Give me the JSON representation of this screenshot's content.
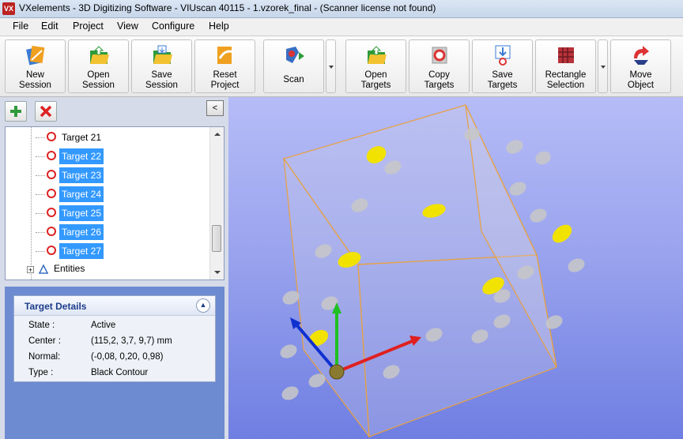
{
  "window": {
    "app_icon_text": "VX",
    "title": "VXelements - 3D Digitizing Software - VIUscan 40115 - 1.vzorek_final - (Scanner license not found)"
  },
  "menu": [
    "File",
    "Edit",
    "Project",
    "View",
    "Configure",
    "Help"
  ],
  "toolbar": {
    "buttons": [
      {
        "label": "New\nSession",
        "icon": "new-session-icon"
      },
      {
        "label": "Open\nSession",
        "icon": "open-session-icon"
      },
      {
        "label": "Save\nSession",
        "icon": "save-session-icon"
      },
      {
        "label": "Reset\nProject",
        "icon": "reset-project-icon"
      },
      {
        "label": "Scan",
        "icon": "scan-icon"
      },
      {
        "label": "Open\nTargets",
        "icon": "open-targets-icon"
      },
      {
        "label": "Copy\nTargets",
        "icon": "copy-targets-icon"
      },
      {
        "label": "Save\nTargets",
        "icon": "save-targets-icon"
      },
      {
        "label": "Rectangle\nSelection",
        "icon": "rectangle-selection-icon"
      },
      {
        "label": "Move\nObject",
        "icon": "move-object-icon"
      }
    ]
  },
  "panel": {
    "add_icon": "plus-icon",
    "remove_icon": "x-icon",
    "collapse_label": "<",
    "tree_items": [
      {
        "label": "Target 21",
        "selected": false
      },
      {
        "label": "Target 22",
        "selected": true
      },
      {
        "label": "Target 23",
        "selected": true
      },
      {
        "label": "Target 24",
        "selected": true
      },
      {
        "label": "Target 25",
        "selected": true
      },
      {
        "label": "Target 26",
        "selected": true
      },
      {
        "label": "Target 27",
        "selected": true
      }
    ],
    "entities_label": "Entities"
  },
  "details": {
    "title": "Target Details",
    "rows": [
      {
        "key": "State :",
        "value": "Active"
      },
      {
        "key": "Center :",
        "value": "(115,2, 3,7, 9,7) mm"
      },
      {
        "key": "Normal:",
        "value": "(-0,08, 0,20, 0,98)"
      },
      {
        "key": "Type :",
        "value": "Black Contour"
      }
    ]
  },
  "colors": {
    "selection": "#3399ff",
    "viewport_top": "#b6bcf7",
    "viewport_bottom": "#6f7ee2",
    "target_selected": "#f2e200",
    "target_unselected": "#c8c8c8",
    "box_edge": "#e8a040"
  }
}
